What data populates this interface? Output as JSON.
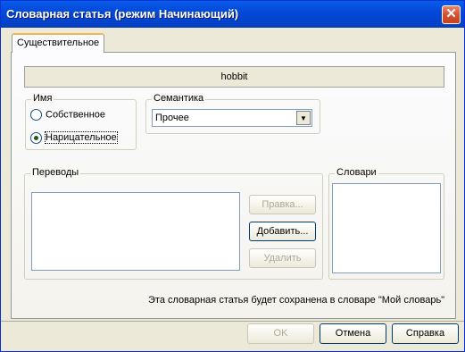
{
  "window": {
    "title": "Словарная статья (режим Начинающий)",
    "close_glyph": "✕"
  },
  "tab": {
    "label": "Существительное"
  },
  "word": "hobbit",
  "name_group": {
    "label": "Имя",
    "options": [
      {
        "label": "Собственное",
        "checked": false
      },
      {
        "label": "Нарицательное",
        "checked": true
      }
    ]
  },
  "semantics": {
    "label": "Семантика",
    "selected": "Прочее"
  },
  "translations": {
    "label": "Переводы",
    "buttons": {
      "edit": "Правка...",
      "add": "Добавить...",
      "delete": "Удалить"
    }
  },
  "dictionaries": {
    "label": "Словари"
  },
  "note": "Эта словарная статья будет сохранена в словаре \"Мой словарь\"",
  "footer": {
    "ok": "OK",
    "cancel": "Отмена",
    "help": "Справка"
  }
}
